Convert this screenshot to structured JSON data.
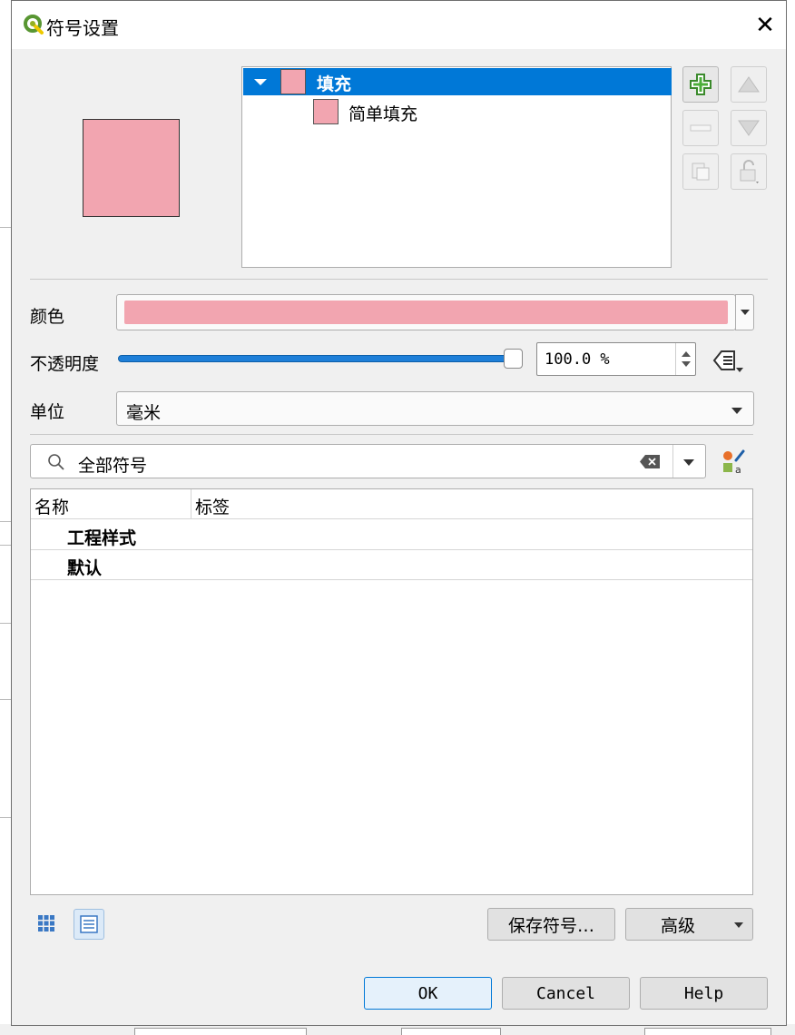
{
  "dialog": {
    "title": "符号设置",
    "close_glyph": "✕"
  },
  "layer_tree": {
    "items": [
      {
        "label": "填充",
        "expanded": true,
        "selected": true,
        "swatch_color": "#f2a5b0"
      },
      {
        "label": "简单填充",
        "selected": false,
        "swatch_color": "#f2a5b0"
      }
    ]
  },
  "side_buttons": [
    {
      "name": "add-symbol-layer",
      "icon": "green-plus-icon",
      "enabled": true
    },
    {
      "name": "move-up",
      "icon": "triangle-up-icon",
      "enabled": false
    },
    {
      "name": "remove-symbol-layer",
      "icon": "minus-icon",
      "enabled": false
    },
    {
      "name": "move-down",
      "icon": "triangle-down-icon",
      "enabled": false
    },
    {
      "name": "duplicate-layer",
      "icon": "duplicate-icon",
      "enabled": false
    },
    {
      "name": "lock-layer-color",
      "icon": "lock-icon",
      "enabled": false
    }
  ],
  "preview": {
    "fill_color": "#f2a5b0",
    "stroke_color": "#333333"
  },
  "form": {
    "color_label": "颜色",
    "color_value": "#f2a5b0",
    "opacity_label": "不透明度",
    "opacity_value": "100.0 %",
    "opacity_fraction": 1.0,
    "unit_label": "单位",
    "unit_value": "毫米"
  },
  "search": {
    "value": "全部符号"
  },
  "symbol_table": {
    "columns": [
      "名称",
      "标签"
    ],
    "rows": [
      {
        "name": "工程样式"
      },
      {
        "name": "默认"
      }
    ]
  },
  "footer": {
    "save_symbol_label": "保存符号…",
    "advanced_label": "高级",
    "ok_label": "OK",
    "cancel_label": "Cancel",
    "help_label": "Help"
  },
  "colors": {
    "selection": "#0078d7",
    "symbol_fill": "#f2a5b0",
    "slider": "#1e7fd8"
  }
}
